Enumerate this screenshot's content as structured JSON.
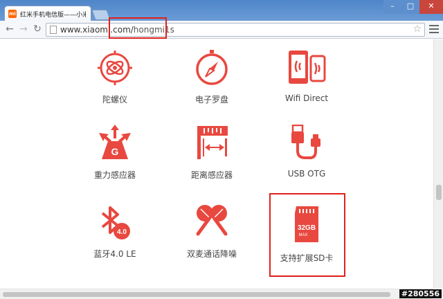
{
  "browser": {
    "tab_icon": "mi",
    "tab_title": "红米手机电信版——小米",
    "url_domain": "www.xiaomi.com/",
    "url_path": "hongmi1s",
    "window_controls": {
      "minimize": "–",
      "maximize": "□",
      "close": "✕"
    }
  },
  "features": [
    {
      "icon": "gyroscope-icon",
      "label": "陀螺仪"
    },
    {
      "icon": "compass-icon",
      "label": "电子罗盘"
    },
    {
      "icon": "wifi-direct-icon",
      "label": "Wifi Direct"
    },
    {
      "icon": "gravity-sensor-icon",
      "label": "重力感应器"
    },
    {
      "icon": "proximity-sensor-icon",
      "label": "距离感应器"
    },
    {
      "icon": "usb-otg-icon",
      "label": "USB OTG"
    },
    {
      "icon": "bluetooth-icon",
      "label": "蓝牙4.0 LE"
    },
    {
      "icon": "dual-mic-icon",
      "label": "双麦通话降噪"
    },
    {
      "icon": "sd-card-icon",
      "label": "支持扩展SD卡"
    }
  ],
  "icon_text": {
    "gravity": "G",
    "bluetooth_badge": "4.0",
    "sd_capacity": "32GB",
    "sd_max": "MAX"
  },
  "watermark": "#280556",
  "colors": {
    "accent": "#e8483f",
    "highlight": "#e0201b"
  }
}
